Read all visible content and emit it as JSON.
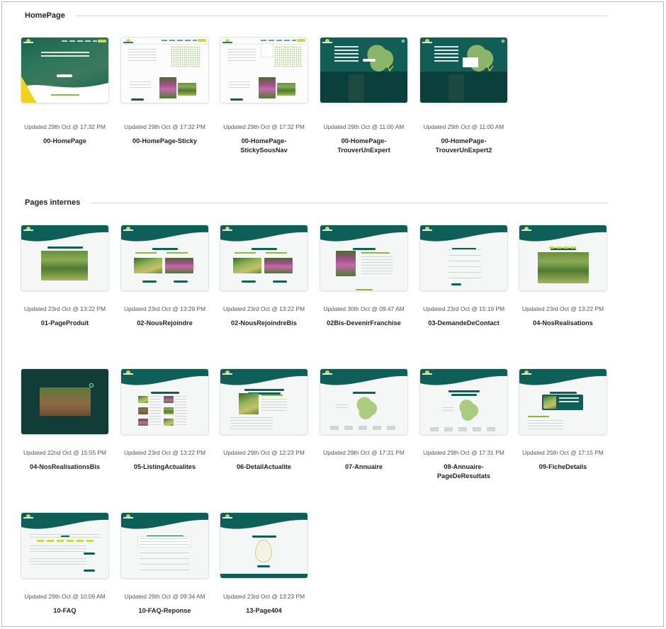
{
  "sections": {
    "homepage": {
      "title": "HomePage",
      "cards": [
        {
          "updated": "Updated 29th Oct @ 17:32 PM",
          "title": "00-HomePage"
        },
        {
          "updated": "Updated 29th Oct @ 17:32 PM",
          "title": "00-HomePage-Sticky"
        },
        {
          "updated": "Updated 29th Oct @ 17:32 PM",
          "title": "00-HomePage-StickySousNav"
        },
        {
          "updated": "Updated 29th Oct @ 11:00 AM",
          "title": "00-HomePage-TrouverUnExpert"
        },
        {
          "updated": "Updated 29th Oct @ 11:00 AM",
          "title": "00-HomePage-TrouverUnExpert2"
        }
      ]
    },
    "pages_internes": {
      "title": "Pages internes",
      "cards": [
        {
          "updated": "Updated 23rd Oct @ 13:22 PM",
          "title": "01-PageProduit"
        },
        {
          "updated": "Updated 23rd Oct @ 13:29 PM",
          "title": "02-NousRejoindre"
        },
        {
          "updated": "Updated 23rd Oct @ 13:22 PM",
          "title": "02-NousRejoindreBis"
        },
        {
          "updated": "Updated 30th Oct @ 09:47 AM",
          "title": "02Bis-DevenirFranchise"
        },
        {
          "updated": "Updated 23rd Oct @ 15:19 PM",
          "title": "03-DemandeDeContact"
        },
        {
          "updated": "Updated 23rd Oct @ 13:22 PM",
          "title": "04-NosRealisations"
        },
        {
          "updated": "Updated 22nd Oct @ 15:55 PM",
          "title": "04-NosRealisationsBis"
        },
        {
          "updated": "Updated 23rd Oct @ 13:22 PM",
          "title": "05-ListingActualites"
        },
        {
          "updated": "Updated 29th Oct @ 12:23 PM",
          "title": "06-DetailActualite"
        },
        {
          "updated": "Updated 29th Oct @ 17:31 PM",
          "title": "07-Annuaire"
        },
        {
          "updated": "Updated 29th Oct @ 17:31 PM",
          "title": "08-Annuaire-PageDeResultats"
        },
        {
          "updated": "Updated 25th Oct @ 17:15 PM",
          "title": "09-FicheDetails"
        },
        {
          "updated": "Updated 29th Oct @ 10:09 AM",
          "title": "10-FAQ"
        },
        {
          "updated": "Updated 29th Oct @ 09:34 AM",
          "title": "10-FAQ-Reponse"
        },
        {
          "updated": "Updated 23rd Oct @ 13:23 PM",
          "title": "13-Page404"
        }
      ]
    }
  },
  "colors": {
    "brand_teal": "#0e5f58",
    "accent_lime": "#c8d84a",
    "background": "#ffffff"
  }
}
